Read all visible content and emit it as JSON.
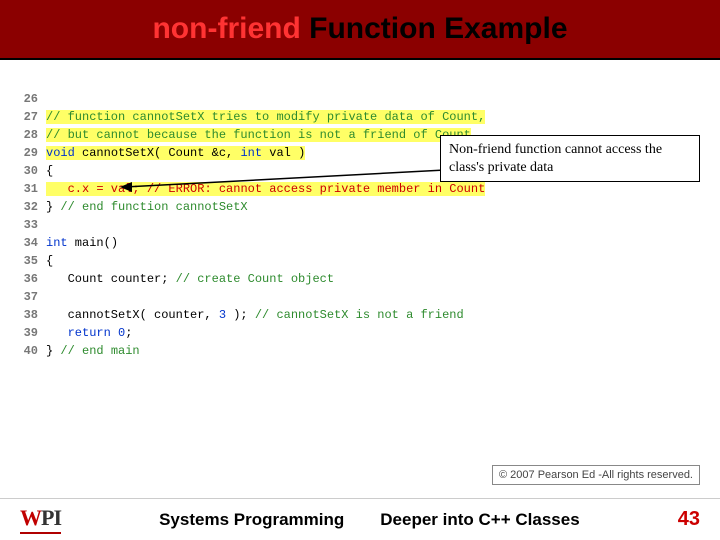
{
  "title": {
    "word1": "non-friend",
    "rest": " Function Example"
  },
  "callout": "Non-friend function cannot access the class's private data",
  "copyright": "© 2007 Pearson Ed -All rights reserved.",
  "footer": {
    "left": "Systems Programming",
    "right": "Deeper into C++ Classes",
    "page": "43"
  },
  "logo": {
    "w": "W",
    "p": "P",
    "i": "I"
  },
  "code": {
    "l26": "",
    "l27": "// function cannotSetX tries to modify private data of Count,",
    "l28": "// but cannot because the function is not a friend of Count",
    "l29a": "void",
    "l29b": " cannotSetX( Count &c, ",
    "l29c": "int",
    "l29d": " val )",
    "l30": "{",
    "l31a": "   c.x = val; ",
    "l31b": "// ERROR: cannot access private member in Count",
    "l32a": "} ",
    "l32b": "// end function cannotSetX",
    "l33": "",
    "l34a": "int",
    "l34b": " main()",
    "l35": "{",
    "l36a": "   Count counter; ",
    "l36b": "// create Count object",
    "l37": "",
    "l38a": "   cannotSetX( counter, ",
    "l38b": "3",
    "l38c": " ); ",
    "l38d": "// cannotSetX is not a friend",
    "l39a": "   return",
    "l39b": " ",
    "l39c": "0",
    "l39d": ";",
    "l40a": "} ",
    "l40b": "// end main"
  },
  "lines": {
    "n26": "26",
    "n27": "27",
    "n28": "28",
    "n29": "29",
    "n30": "30",
    "n31": "31",
    "n32": "32",
    "n33": "33",
    "n34": "34",
    "n35": "35",
    "n36": "36",
    "n37": "37",
    "n38": "38",
    "n39": "39",
    "n40": "40"
  }
}
